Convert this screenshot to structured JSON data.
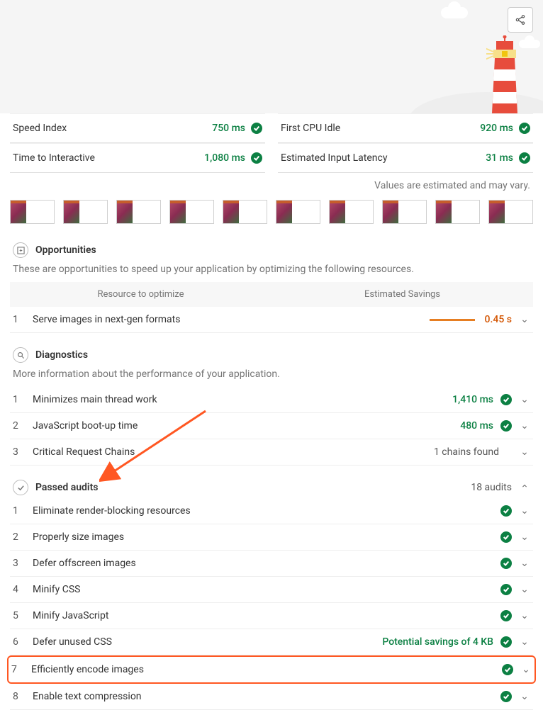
{
  "metrics": {
    "left": [
      {
        "label": "Speed Index",
        "value": "750 ms"
      },
      {
        "label": "Time to Interactive",
        "value": "1,080 ms"
      }
    ],
    "right": [
      {
        "label": "First CPU Idle",
        "value": "920 ms"
      },
      {
        "label": "Estimated Input Latency",
        "value": "31 ms"
      }
    ]
  },
  "disclaimer": "Values are estimated and may vary.",
  "opportunities": {
    "title": "Opportunities",
    "sub": "These are opportunities to speed up your application by optimizing the following resources.",
    "head_resource": "Resource to optimize",
    "head_savings": "Estimated Savings",
    "items": [
      {
        "num": "1",
        "label": "Serve images in next-gen formats",
        "savings": "0.45 s"
      }
    ]
  },
  "diagnostics": {
    "title": "Diagnostics",
    "sub": "More information about the performance of your application.",
    "items": [
      {
        "num": "1",
        "label": "Minimizes main thread work",
        "value": "1,410 ms",
        "check": true
      },
      {
        "num": "2",
        "label": "JavaScript boot-up time",
        "value": "480 ms",
        "check": true
      },
      {
        "num": "3",
        "label": "Critical Request Chains",
        "value": "1 chains found",
        "check": false
      }
    ]
  },
  "passed": {
    "title": "Passed audits",
    "count": "18 audits",
    "items": [
      {
        "num": "1",
        "label": "Eliminate render-blocking resources",
        "extra": ""
      },
      {
        "num": "2",
        "label": "Properly size images",
        "extra": ""
      },
      {
        "num": "3",
        "label": "Defer offscreen images",
        "extra": ""
      },
      {
        "num": "4",
        "label": "Minify CSS",
        "extra": ""
      },
      {
        "num": "5",
        "label": "Minify JavaScript",
        "extra": ""
      },
      {
        "num": "6",
        "label": "Defer unused CSS",
        "extra": "Potential savings of 4 KB"
      },
      {
        "num": "7",
        "label": "Efficiently encode images",
        "extra": "",
        "highlight": true
      },
      {
        "num": "8",
        "label": "Enable text compression",
        "extra": ""
      }
    ]
  }
}
